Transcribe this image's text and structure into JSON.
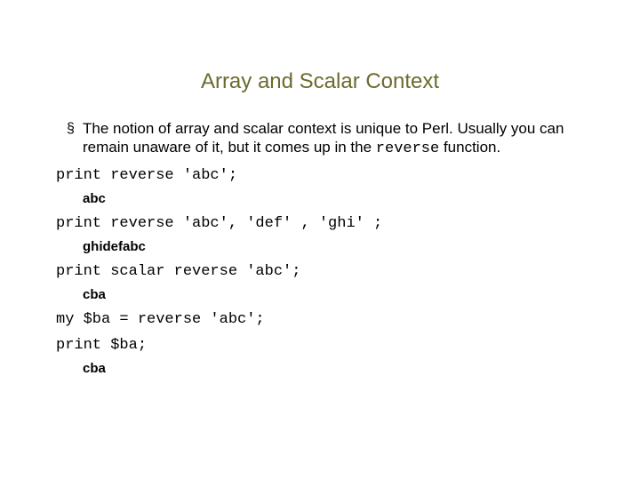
{
  "title": "Array and Scalar Context",
  "bullet": {
    "glyph": "§",
    "text_pre": "The notion of array and scalar context is unique to Perl. Usually you can remain unaware of it, but it comes up in the ",
    "code": "reverse",
    "text_post": " function."
  },
  "lines": {
    "code1": "print reverse 'abc';",
    "out1": "abc",
    "code2": "print reverse 'abc', 'def' , 'ghi' ;",
    "out2": "ghidefabc",
    "code3": "print scalar reverse 'abc';",
    "out3": "cba",
    "code4": "my $ba = reverse 'abc';",
    "code5": "print $ba;",
    "out5": "cba"
  }
}
